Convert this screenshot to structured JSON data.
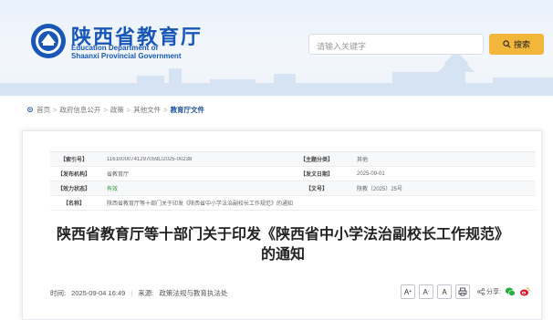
{
  "header": {
    "title_cn": "陕西省教育厅",
    "title_en_line1": "Education Department of",
    "title_en_line2": "Shaanxi Provincial Government",
    "search_placeholder": "请输入关键字",
    "search_button": "搜索"
  },
  "breadcrumb": {
    "items": [
      "首页",
      "政府信息公开",
      "政策",
      "其他文件"
    ],
    "separator": ">",
    "current": "教育厅文件"
  },
  "meta": {
    "rows": [
      {
        "k1": "【索引号】",
        "v1": "11610000741297059L/2025-00238",
        "k2": "【主题分类】",
        "v2": "其他"
      },
      {
        "k1": "【发布机构】",
        "v1": "省教育厅",
        "k2": "【发文日期】",
        "v2": "2025-09-01"
      },
      {
        "k1": "【效力状态】",
        "v1": "有效",
        "k2": "【文号】",
        "v2": "陕教〔2025〕25号"
      },
      {
        "k1": "【名称】",
        "v1": "陕西省教育厅等十部门关于印发《陕西省中小学法治副校长工作规范》的通知"
      }
    ]
  },
  "article": {
    "title_line1": "陕西省教育厅等十部门关于印发《陕西省中小学法治副校长工作规范》",
    "title_line2": "的通知",
    "time_label": "时间:",
    "time_value": "2025-09-04 16:49",
    "source_label": "来源:",
    "source_value": "政策法规与教育执法处",
    "font_large": "A",
    "font_medium": "A",
    "font_small": "A",
    "share_label": "分享:"
  },
  "colors": {
    "brand_blue": "#1857b8",
    "search_button": "#f2b63b",
    "valid_green": "#2e9a3c"
  }
}
